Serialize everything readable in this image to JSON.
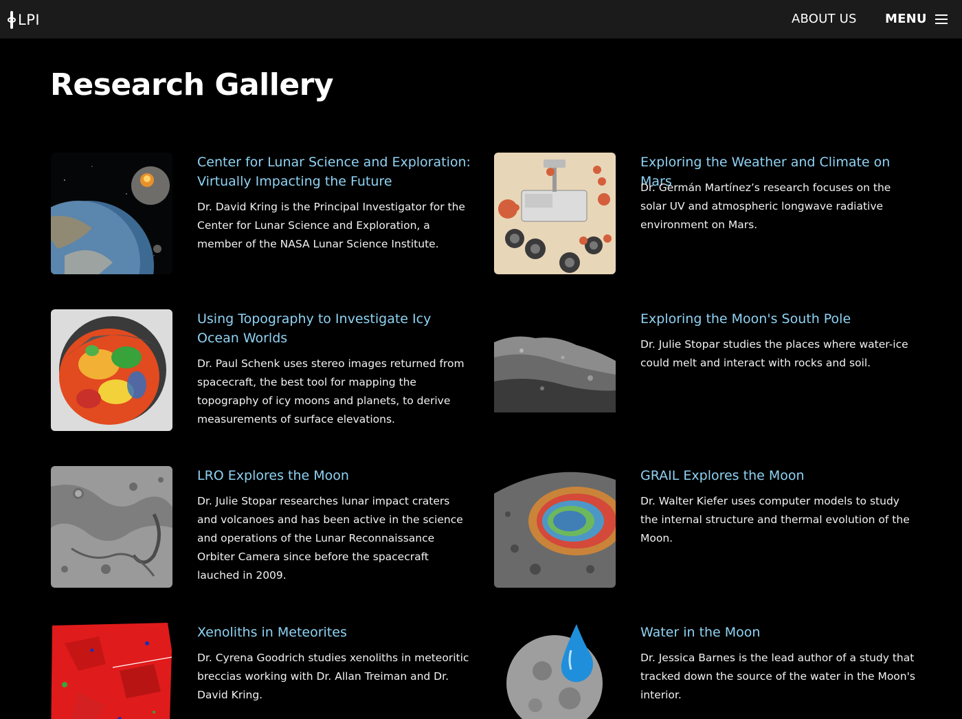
{
  "header": {
    "logo_text": "LPI",
    "about_label": "ABOUT US",
    "menu_label": "MENU",
    "menu_icon": "hamburger-icon"
  },
  "page": {
    "title": "Research Gallery"
  },
  "cards": [
    {
      "title": "Center for Lunar Science and Exploration: Virtually Impacting the Future",
      "description": "Dr. David Kring is the Principal Investigator for the Center for Lunar Science and Exploration, a member of the NASA Lunar Science Institute.",
      "image": "earth-moon-impact-image"
    },
    {
      "title": "Exploring the Weather and Climate on Mars",
      "description": "Dr. Germán Martínez’s research focuses on the solar UV and atmospheric longwave radiative environment on Mars.",
      "image": "mars-rover-image"
    },
    {
      "title": "Using Topography to Investigate Icy Ocean Worlds",
      "description": "Dr. Paul Schenk uses stereo images returned from spacecraft, the best tool for mapping the topography of icy moons and planets, to derive measurements of surface elevations.",
      "image": "icy-moon-topography-image"
    },
    {
      "title": "Exploring the Moon's South Pole",
      "description": "Dr. Julie Stopar studies the places where water-ice could melt and interact with rocks and soil.",
      "image": "lunar-south-pole-image"
    },
    {
      "title": "LRO Explores the Moon",
      "description": "Dr. Julie Stopar researches lunar impact craters and volcanoes and has been active in the science and operations of the Lunar Reconnaissance Orbiter Camera since before the spacecraft lauched in 2009.",
      "image": "lunar-surface-image"
    },
    {
      "title": "GRAIL Explores the Moon",
      "description": "Dr. Walter Kiefer uses computer models to study the internal structure and thermal evolution of the Moon.",
      "image": "gravity-map-crater-image"
    },
    {
      "title": "Xenoliths in Meteorites",
      "description": "Dr. Cyrena Goodrich studies xenoliths in meteoritic breccias working with Dr. Allan Treiman and Dr. David Kring.",
      "image": "meteorite-xenolith-image"
    },
    {
      "title": "Water in the Moon",
      "description": "Dr. Jessica Barnes is the lead author of a study that tracked down the source of the water in the Moon's interior.",
      "image": "moon-water-drop-image"
    }
  ]
}
